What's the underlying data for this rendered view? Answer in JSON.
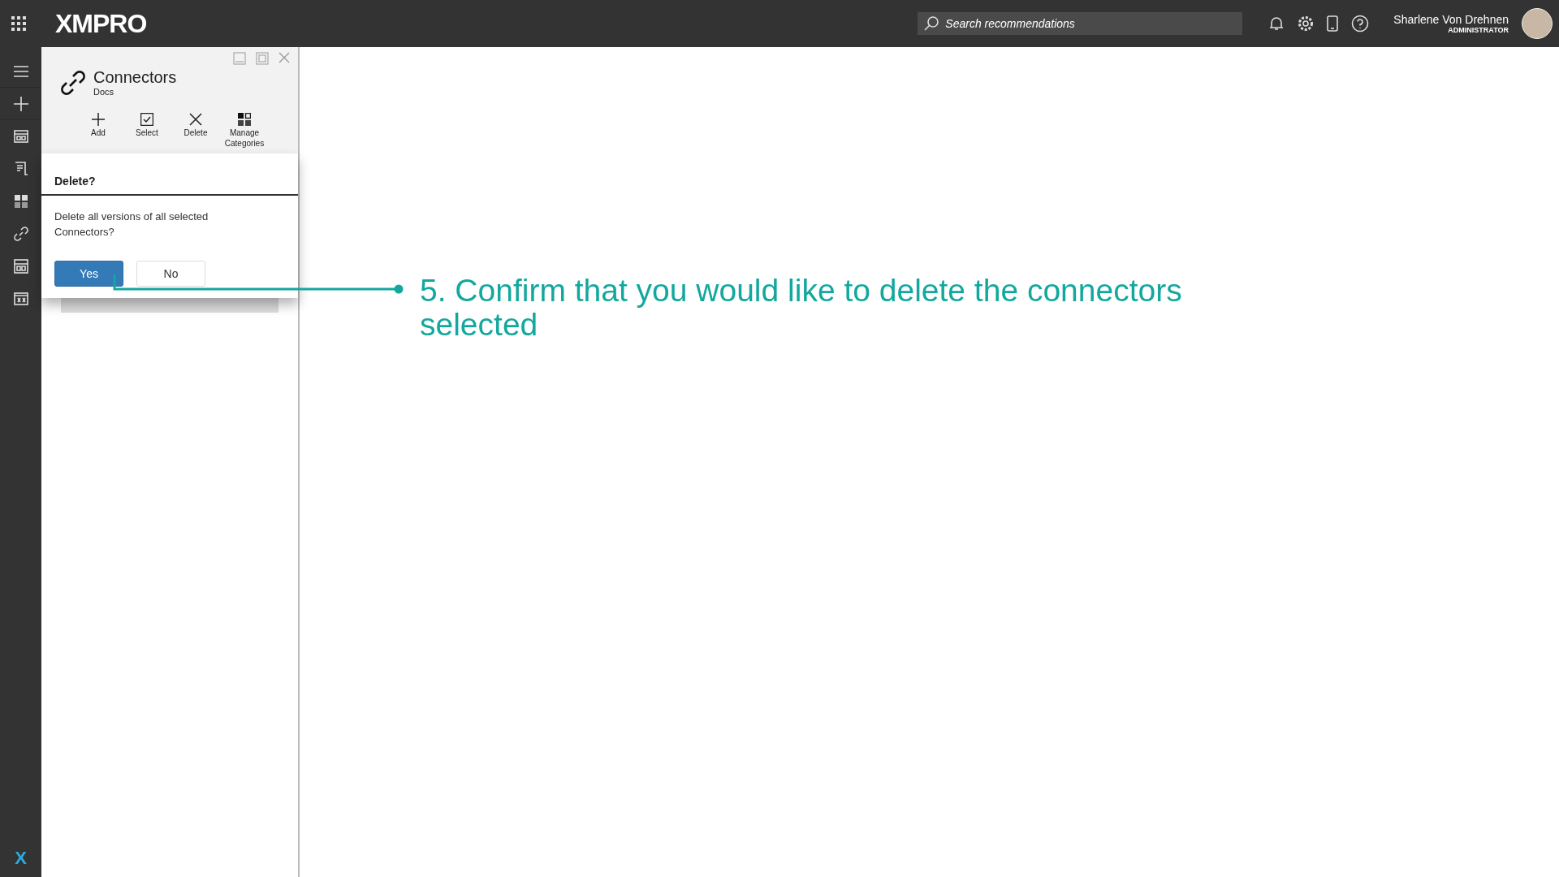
{
  "topbar": {
    "logo": "XMPRO",
    "search": {
      "placeholder": "Search recommendations"
    },
    "user": {
      "name": "Sharlene Von Drehnen",
      "role": "ADMINISTRATOR"
    }
  },
  "rail": {
    "items": [
      {
        "kind": "menu"
      },
      {
        "kind": "add"
      },
      {
        "kind": "layout"
      },
      {
        "kind": "scroll"
      },
      {
        "kind": "grid"
      },
      {
        "kind": "link"
      },
      {
        "kind": "calc"
      },
      {
        "kind": "variable"
      }
    ],
    "footer_logo": "X"
  },
  "panel": {
    "title": "Connectors",
    "subtitle": "Docs",
    "actions": [
      {
        "kind": "add",
        "label": "Add"
      },
      {
        "kind": "select",
        "label": "Select"
      },
      {
        "kind": "delete",
        "label": "Delete"
      },
      {
        "kind": "categories",
        "label": "Manage Categories"
      }
    ]
  },
  "dialog": {
    "title": "Delete?",
    "message": "Delete all versions of all selected Connectors?",
    "buttons": [
      {
        "label": "Yes",
        "selected": true
      },
      {
        "label": "No",
        "selected": false
      }
    ]
  },
  "callout": {
    "text": "5. Confirm that you would like to delete the connectors selected"
  }
}
